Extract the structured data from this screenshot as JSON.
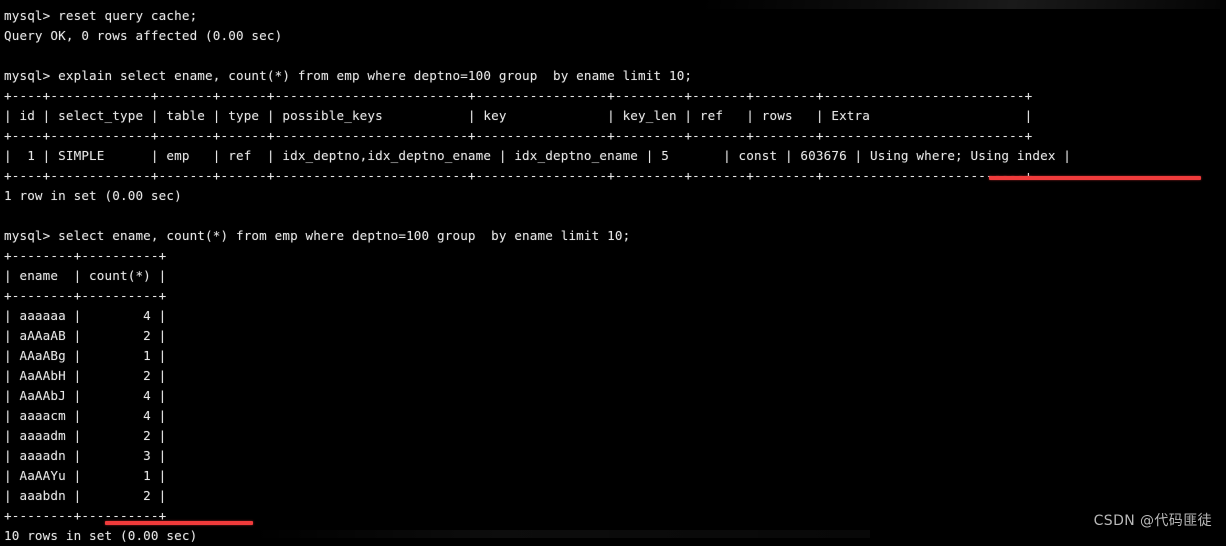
{
  "terminal": {
    "prompt": "mysql>",
    "text_color": "#e6e6e6",
    "background_color": "#000000",
    "highlight_color": "#ef3b3b",
    "lines": [
      "mysql> reset query cache;",
      "Query OK, 0 rows affected (0.00 sec)",
      "",
      "mysql> explain select ename, count(*) from emp where deptno=100 group  by ename limit 10;",
      "+----+-------------+-------+------+-------------------------+-----------------+---------+-------+--------+--------------------------+",
      "| id | select_type | table | type | possible_keys           | key             | key_len | ref   | rows   | Extra                    |",
      "+----+-------------+-------+------+-------------------------+-----------------+---------+-------+--------+--------------------------+",
      "|  1 | SIMPLE      | emp   | ref  | idx_deptno,idx_deptno_ename | idx_deptno_ename | 5       | const | 603676 | Using where; Using index |",
      "+----+-------------+-------+------+-------------------------+-----------------+---------+-------+--------+--------------------------+",
      "1 row in set (0.00 sec)",
      "",
      "mysql> select ename, count(*) from emp where deptno=100 group  by ename limit 10;",
      "+--------+----------+",
      "| ename  | count(*) |",
      "+--------+----------+",
      "| aaaaaa |        4 |",
      "| aAAaAB |        2 |",
      "| AAaABg |        1 |",
      "| AaAAbH |        2 |",
      "| AaAAbJ |        4 |",
      "| aaaacm |        4 |",
      "| aaaadm |        2 |",
      "| aaaadn |        3 |",
      "| AaAAYu |        1 |",
      "| aaabdn |        2 |",
      "+--------+----------+",
      "10 rows in set (0.00 sec)"
    ],
    "commands": [
      "reset query cache;",
      "explain select ename, count(*) from emp where deptno=100 group  by ename limit 10;",
      "select ename, count(*) from emp where deptno=100 group  by ename limit 10;"
    ],
    "status_messages": [
      "Query OK, 0 rows affected (0.00 sec)",
      "1 row in set (0.00 sec)",
      "10 rows in set (0.00 sec)"
    ]
  },
  "explain_table": {
    "columns": [
      "id",
      "select_type",
      "table",
      "type",
      "possible_keys",
      "key",
      "key_len",
      "ref",
      "rows",
      "Extra"
    ],
    "rows": [
      {
        "id": "1",
        "select_type": "SIMPLE",
        "table": "emp",
        "type": "ref",
        "possible_keys": "idx_deptno,idx_deptno_ename",
        "key": "idx_deptno_ename",
        "key_len": "5",
        "ref": "const",
        "rows": "603676",
        "Extra": "Using where; Using index"
      }
    ]
  },
  "result_table": {
    "columns": [
      "ename",
      "count(*)"
    ],
    "rows": [
      [
        "aaaaaa",
        "4"
      ],
      [
        "aAAaAB",
        "2"
      ],
      [
        "AAaABg",
        "1"
      ],
      [
        "AaAAbH",
        "2"
      ],
      [
        "AaAAbJ",
        "4"
      ],
      [
        "aaaacm",
        "4"
      ],
      [
        "aaaadm",
        "2"
      ],
      [
        "aaaadn",
        "3"
      ],
      [
        "AaAAYu",
        "1"
      ],
      [
        "aaabdn",
        "2"
      ]
    ]
  },
  "annotations": {
    "extra_underline_target": "Using where; Using index",
    "rows_underline_target": "set (0.00 sec)"
  },
  "watermark": {
    "text": "CSDN @代码匪徒"
  }
}
